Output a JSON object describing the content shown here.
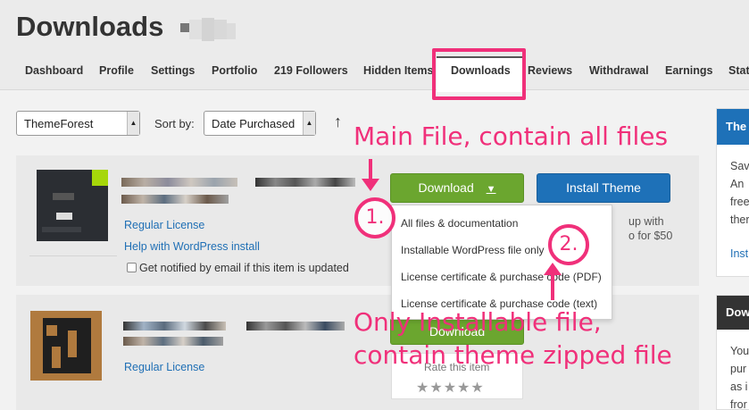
{
  "header": {
    "title": "Downloads",
    "tabs": [
      "Dashboard",
      "Profile",
      "Settings",
      "Portfolio",
      "219 Followers",
      "Hidden Items",
      "Downloads",
      "Reviews",
      "Withdrawal",
      "Earnings",
      "Stat"
    ],
    "active_tab": "Downloads"
  },
  "filters": {
    "marketplace": "ThemeForest",
    "sort_label": "Sort by:",
    "sort_value": "Date Purchased",
    "sort_direction_icon": "arrow-up-icon"
  },
  "items": [
    {
      "links": [
        "Regular License",
        "Help with WordPress install"
      ],
      "notify_label": "Get notified by email if this item is updated",
      "download_label": "Download",
      "install_label": "Install Theme",
      "promo_line1": "up with",
      "promo_line2": "o for $50"
    },
    {
      "links": [
        "Regular License"
      ],
      "download_label": "Download",
      "rate_label": "Rate this item",
      "stars": "★★★★★"
    }
  ],
  "download_menu": [
    "All files & documentation",
    "Installable WordPress file only",
    "License certificate & purchase code (PDF)",
    "License certificate & purchase code (text)"
  ],
  "sidebar": {
    "box1": {
      "title": "The",
      "lines": [
        "Sav",
        "An",
        "free",
        "ther"
      ],
      "link": "Inst"
    },
    "box2": {
      "title": "Dow",
      "lines": [
        "You",
        "pur",
        "as i",
        "fror"
      ]
    }
  },
  "annotations": {
    "main_file": "Main File, contain all files",
    "installable_line1": "Only Installable file,",
    "installable_line2": "contain theme zipped file",
    "step1": "1.",
    "step2": "2."
  },
  "colors": {
    "highlight": "#f0307a",
    "download_green": "#6ba62f",
    "install_blue": "#1e71b8",
    "link_blue": "#1f6fb5"
  }
}
